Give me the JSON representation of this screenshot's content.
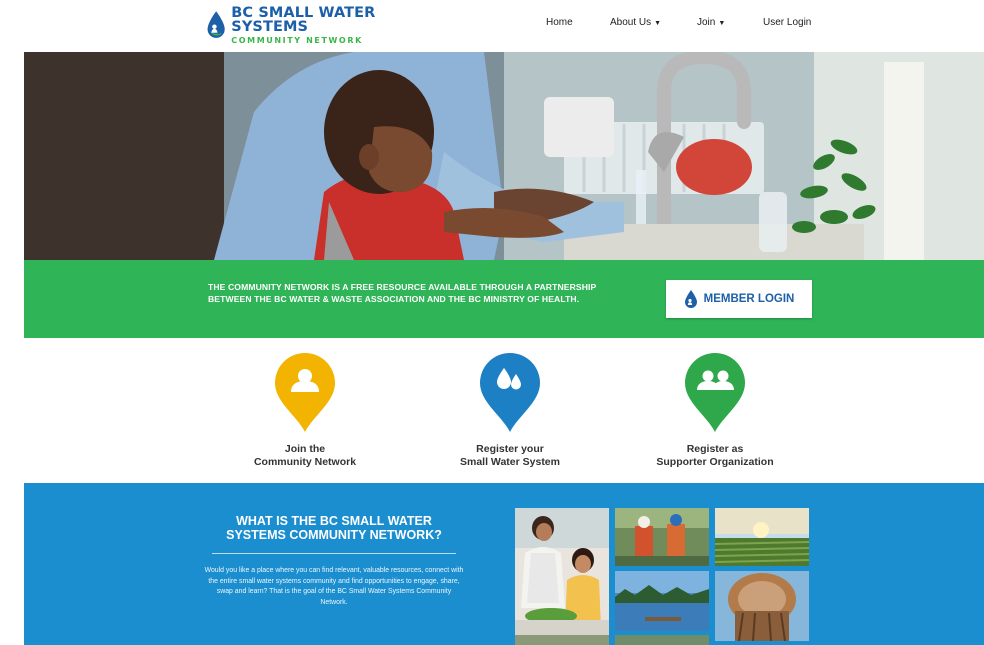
{
  "header": {
    "logo_title": "BC SMALL WATER SYSTEMS",
    "logo_subtitle": "COMMUNITY NETWORK",
    "nav": [
      {
        "label": "Home"
      },
      {
        "label": "About Us"
      },
      {
        "label": "Join"
      },
      {
        "label": "User Login"
      }
    ]
  },
  "band": {
    "text_line1": "THE COMMUNITY NETWORK IS A FREE RESOURCE AVAILABLE THROUGH A PARTNERSHIP",
    "text_line2": "BETWEEN THE BC WATER & WASTE ASSOCIATION AND THE BC MINISTRY OF HEALTH.",
    "button_label": "MEMBER LOGIN"
  },
  "pins": [
    {
      "line1": "Join the",
      "line2": "Community Network",
      "color": "#f2b400",
      "icon": "user-icon"
    },
    {
      "line1": "Register your",
      "line2": "Small Water System",
      "color": "#1d7fc4",
      "icon": "water-drops-icon"
    },
    {
      "line1": "Register as",
      "line2": "Supporter Organization",
      "color": "#2ea84a",
      "icon": "group-icon"
    }
  ],
  "about": {
    "title_line1": "WHAT IS THE BC SMALL WATER",
    "title_line2": "SYSTEMS COMMUNITY NETWORK?",
    "body": "Would you like a place where you can find relevant, valuable resources, connect with the entire small water systems community and find opportunities to engage, share, swap and learn? That is the goal of the BC Small Water Systems Community Network."
  },
  "colors": {
    "brand_blue": "#1d5fa8",
    "brand_green": "#3ab54a",
    "band_green": "#2fb457",
    "section_blue": "#1b8ed0"
  }
}
